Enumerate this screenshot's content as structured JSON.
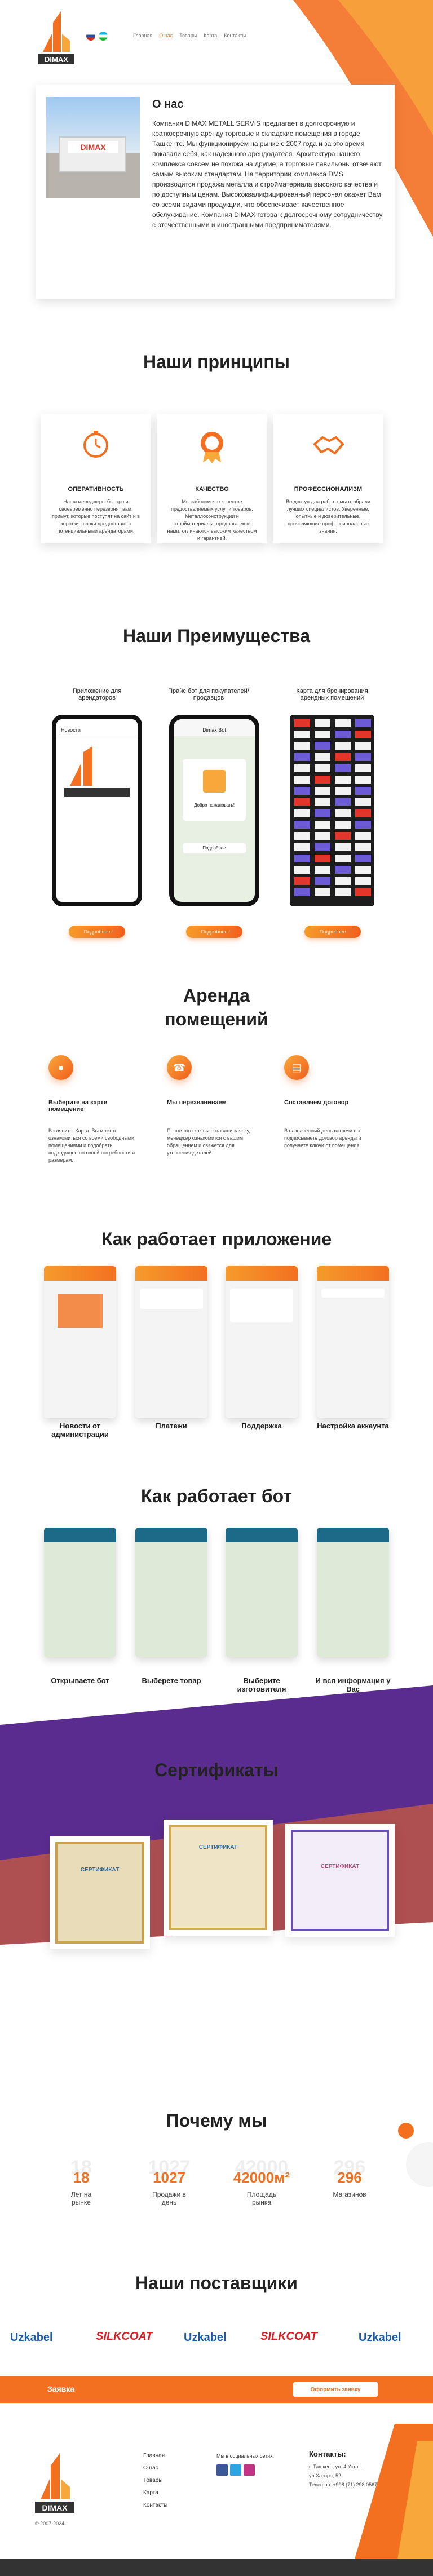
{
  "colors": {
    "accent": "#f37021",
    "dark": "#222222",
    "purple": "#5b2c8f",
    "green_teal": "#0b7a8e"
  },
  "header": {
    "logo_text": "DIMAX",
    "nav": [
      "Главная",
      "О нас",
      "Товары",
      "Карта",
      "Контакты"
    ]
  },
  "about": {
    "title": "О нас",
    "text": "Компания DIMAX METALL SERVIS предлагает в долгосрочную и краткосрочную аренду торговые и складские помещения в городе Ташкенте. Мы функционируем на рынке с 2007 года и за это время показали себя, как надежного арендодателя. Архитектура нашего комплекса совсем не похожа на другие, а торговые павильоны отвечают самым высоким стандартам. На территории комплекса DMS производится продажа металла и стройматериала высокого качества и по доступным ценам. Высококвалифицированный персонал окажет Вам со всеми видами продукции, что обеспечивает качественное обслуживание. Компания DIMAX готова к долгосрочному сотрудничеству с отечественными и иностранными предпринимателями."
  },
  "principles": {
    "title": "Наши принципы",
    "items": [
      {
        "title": "ОПЕРАТИВНОСТЬ",
        "icon": "stopwatch-icon",
        "text": "Наши менеджеры быстро и своевременно перезвонят вам, примут, которые поступят на сайт и в короткие сроки предоставят с потенциальными арендаторами."
      },
      {
        "title": "КАЧЕСТВО",
        "icon": "medal-icon",
        "text": "Мы заботимся о качестве предоставляемых услуг и товаров. Металлоконструкции и стройматериалы, предлагаемые нами, отличаются высоким качеством и гарантией."
      },
      {
        "title": "ПРОФЕССИОНАЛИЗМ",
        "icon": "handshake-icon",
        "text": "Во доступ для работы мы отобрали лучших специалистов. Уверенные, опытные и доверительные, проявляющие профессиональные знания."
      }
    ]
  },
  "advantages": {
    "title": "Наши Преимущества",
    "items": [
      {
        "caption": "Приложение для арендаторов",
        "button": "Подробнее"
      },
      {
        "caption": "Прайс бот для покупателей/продавцов",
        "button": "Подробнее"
      },
      {
        "caption": "Карта для бронирования арендных помещений",
        "button": "Подробнее"
      }
    ],
    "phone_app_label": "Новости",
    "phone_bot_title": "Dimax Bot",
    "phone_bot_msg": "Добро пожаловать!",
    "phone_bot_btn": "Подробнее"
  },
  "rent": {
    "title_line1": "Аренда",
    "title_line2": "помещений",
    "steps": [
      {
        "icon": "map-pin-icon",
        "title": "Выберите на карте помещение",
        "text": "Взгляните: Карта. Вы можете ознакомиться со всеми свободными помещениями и подобрать подходящее по своей потребности и размерам."
      },
      {
        "icon": "phone-icon",
        "title": "Мы перезваниваем",
        "text": "После того как вы оставили заявку, менеджер ознакомится с вашим обращением и свяжется для уточнения деталей."
      },
      {
        "icon": "document-icon",
        "title": "Составляем договор",
        "text": "В назначенный день встречи вы подписываете договор аренды и получаете ключи от помещения."
      }
    ]
  },
  "how_app": {
    "title": "Как работает приложение",
    "items": [
      "Новости от администрации",
      "Платежи",
      "Поддержка",
      "Настройка аккаунта"
    ]
  },
  "how_bot": {
    "title": "Как работает бот",
    "items": [
      "Открываете бот",
      "Выберете товар",
      "Выберите изготовителя",
      "И вся информация у Вас"
    ]
  },
  "certificates": {
    "title": "Сертификаты",
    "cert_labels": [
      "СЕРТИФИКАТ",
      "СЕРТИФИКАТ",
      "СЕРТИФИКАТ"
    ]
  },
  "why": {
    "title": "Почему мы",
    "stats": [
      {
        "value": "18",
        "ghost": "18",
        "label": "Лет на рынке"
      },
      {
        "value": "1027",
        "ghost": "1027",
        "label": "Продажи в день"
      },
      {
        "value": "42000м²",
        "ghost": "42000",
        "label": "Площадь рынка"
      },
      {
        "value": "296",
        "ghost": "296",
        "label": "Магазинов"
      }
    ]
  },
  "suppliers": {
    "title": "Наши поставщики",
    "names": [
      "Uzkabel",
      "SILKCOAT",
      "Uzkabel",
      "SILKCOAT",
      "Uzkabel"
    ]
  },
  "request": {
    "label": "Заявка",
    "button": "Оформить заявку"
  },
  "footer": {
    "links": [
      "Главная",
      "О нас",
      "Товары",
      "Карта",
      "Контакты"
    ],
    "social_title": "Мы в социальных сетях:",
    "contacts_title": "Контакты:",
    "contacts": [
      "г. Ташкент, ул. 4 Уста...",
      "ул.Хазора, 52",
      "Телефон: +998 (71) 298 0567"
    ],
    "copyright": "© 2007-2024"
  }
}
